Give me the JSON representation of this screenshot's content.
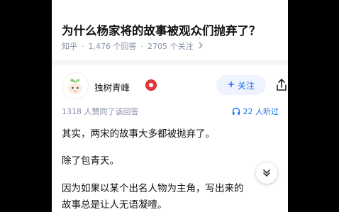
{
  "question": {
    "title": "为什么杨家将的故事被观众们抛弃了？",
    "source": "知乎",
    "answers": "1,476 个回答",
    "follows": "2705 个关注"
  },
  "author": {
    "name": "独树青峰",
    "follow_label": "关注"
  },
  "stats": {
    "agree": "1318 人赞同了该回答",
    "listen": "22 人听过"
  },
  "paragraphs": [
    "其实，两宋的故事大多都被抛弃了。",
    "除了包青天。",
    "因为如果以某个出名人物为主角，写出来的",
    "故事总是让人无语凝噎。"
  ],
  "colors": {
    "accent": "#1772f6",
    "meta": "#8590a6",
    "badge": "#e03a3a"
  },
  "icons": [
    "share-icon",
    "headphone-icon",
    "chevron-down-icon",
    "plus-icon",
    "chevron-right-icon",
    "avatar-icon",
    "badge-icon"
  ]
}
